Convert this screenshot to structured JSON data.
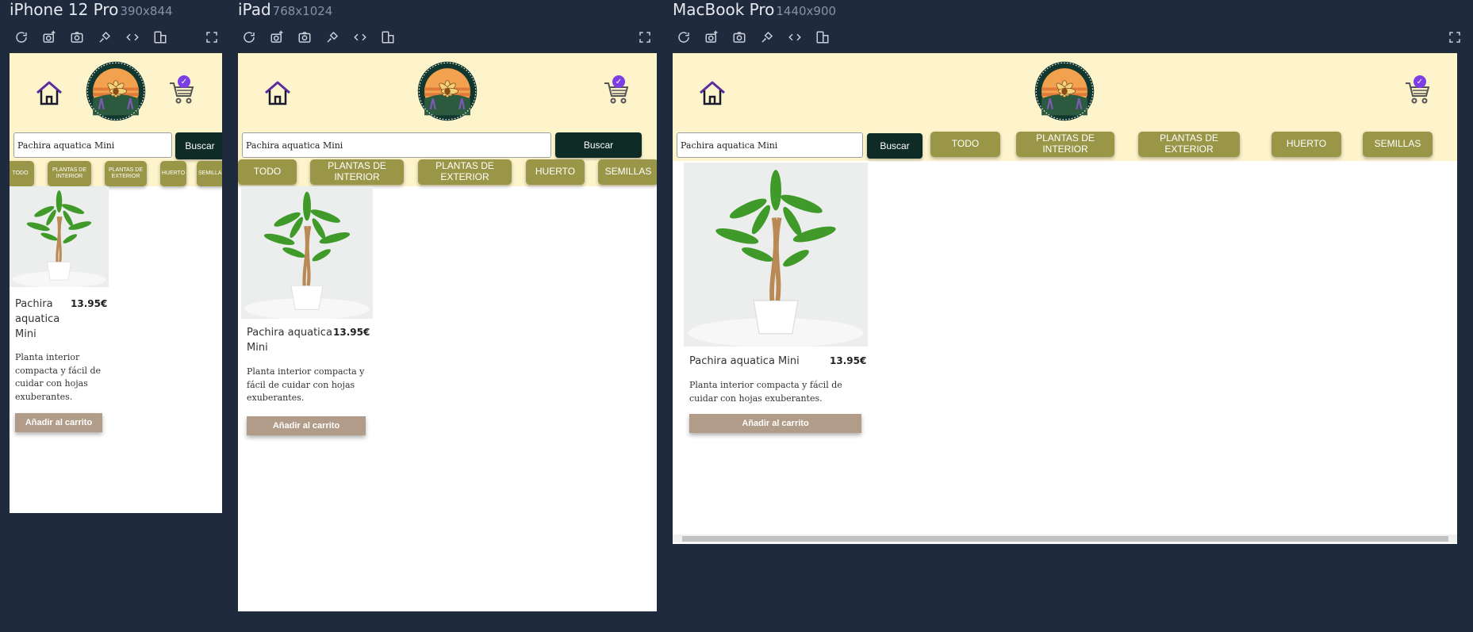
{
  "devices": [
    {
      "name": "iPhone 12 Pro",
      "size": "390x844"
    },
    {
      "name": "iPad",
      "size": "768x1024"
    },
    {
      "name": "MacBook Pro",
      "size": "1440x900"
    }
  ],
  "toolbar_icons": [
    "refresh-icon",
    "screenshot-add-icon",
    "camera-icon",
    "rotate-pin-icon",
    "code-icon",
    "device-switch-icon",
    "fullscreen-icon"
  ],
  "store": {
    "logo_text": "FLORA · MORA",
    "cart_count": "✓",
    "search": {
      "value": "Pachira aquatica Mini",
      "button": "Buscar"
    },
    "categories": {
      "todo": "TODO",
      "interior": "PLANTAS DE INTERIOR",
      "exterior": "PLANTAS DE EXTERIOR",
      "huerto": "HUERTO",
      "semillas": "SEMILLAS"
    },
    "product": {
      "name": "Pachira aquatica Mini",
      "price": "13.95€",
      "description": "Planta interior compacta y fácil de cuidar con hojas exuberantes.",
      "add_button": "Añadir al carrito"
    }
  },
  "colors": {
    "header_bg": "#fdf4cc",
    "category_btn": "#9a9647",
    "search_btn": "#0f2b26",
    "add_btn": "#b09c88",
    "badge": "#7b3fe4"
  }
}
